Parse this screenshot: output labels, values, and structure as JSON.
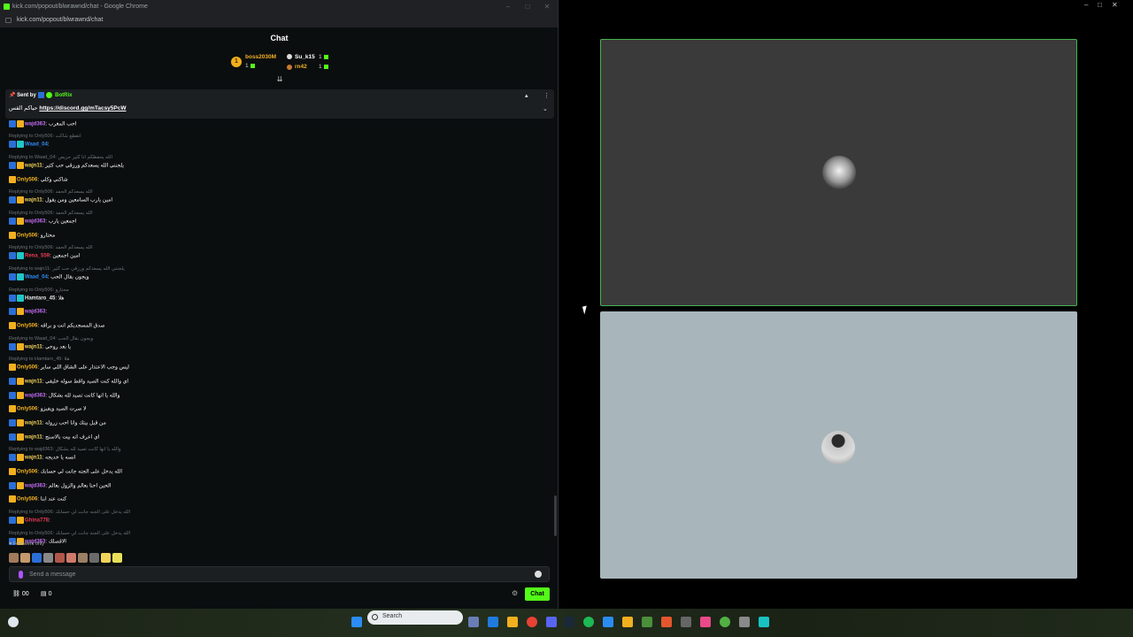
{
  "browser": {
    "title": "kick.com/popout/blwrawnd/chat - Google Chrome",
    "url": "kick.com/popout/blwrawnd/chat"
  },
  "chat": {
    "header": "Chat",
    "leaderboard": [
      {
        "rank": "1",
        "name": "boss2030M",
        "count": "1",
        "color": "#f2b01e"
      },
      {
        "rank": "",
        "name": "Su_k15",
        "count": "1",
        "color": "#ffffff"
      },
      {
        "rank": "",
        "name": "rn42",
        "count": "1",
        "color": "#f2b01e"
      }
    ],
    "pinned": {
      "sent_by": "Sent by",
      "bot_name": "BotRix",
      "text": "حياكم القس",
      "link": "https://discord.gg/mTacsy5PcW"
    },
    "messages": [
      {
        "reply": "",
        "user": "wajd363",
        "color": "#c36cf5",
        "text": "احب المغرب"
      },
      {
        "reply": "Replying to Only506: انقطع شاكت",
        "user": "Waad_04",
        "color": "#2b8cf4",
        "text": ""
      },
      {
        "reply": "Replying to Waad_04: الله يحفظكم انا كثير حريص",
        "user": "wajn11",
        "color": "#f2d35a",
        "text": "يلجنني الله يسعدكم ورزقي حب كثير"
      },
      {
        "reply": "",
        "user": "Only506",
        "color": "#f2b01e",
        "text": "شاكني وكلي"
      },
      {
        "reply": "Replying to Only506: الله يسعدكم الحمد",
        "user": "wajn11",
        "color": "#f2d35a",
        "text": "امين يارب السامعين ومن يقول"
      },
      {
        "reply": "Replying to Only506: الله يسعدكم الحمد",
        "user": "wajd363",
        "color": "#c36cf5",
        "text": "اجمعين يارب"
      },
      {
        "reply": "",
        "user": "Only506",
        "color": "#f2b01e",
        "text": "محتارو"
      },
      {
        "reply": "Replying to Only506: الله يسعدكم الحمد",
        "user": "Rena_559",
        "color": "#ea3a55",
        "text": "امين اجمعين"
      },
      {
        "reply": "Replying to wajn11: يلجنني الله يسعدكم ورزقي حب كثير",
        "user": "Waad_04",
        "color": "#2b8cf4",
        "text": "ويجون بقال الحب"
      },
      {
        "reply": "Replying to Only506: محتارو",
        "user": "Hamtaro_45",
        "color": "#e8e8e8",
        "text": "هلا"
      },
      {
        "reply": "",
        "user": "wajd363",
        "color": "#c36cf5",
        "text": ""
      },
      {
        "reply": "",
        "user": "Only506",
        "color": "#f2b01e",
        "text": "صدق المسجديكم انت و براقه"
      },
      {
        "reply": "Replying to Waad_04: ويجون بقال الحب",
        "user": "wajn11",
        "color": "#f2d35a",
        "text": "يا بعد روحي"
      },
      {
        "reply": "Replying to Hamtaro_45: هلا",
        "user": "Only506",
        "color": "#f2b01e",
        "text": "ليس وجب الاعتذار على الشاق اللي ساير"
      },
      {
        "reply": "",
        "user": "wajn11",
        "color": "#f2d35a",
        "text": "اي والله كنت الصيد واقط سوله خليقي"
      },
      {
        "reply": "",
        "user": "wajd363",
        "color": "#c36cf5",
        "text": "والله يا انها كانت تصيد لله بشكال"
      },
      {
        "reply": "",
        "user": "Only506",
        "color": "#f2b01e",
        "text": "لا صرت الصيد ويفيزو"
      },
      {
        "reply": "",
        "user": "wajn11",
        "color": "#f2d35a",
        "text": "من قبل بيتك وانا احب زروله"
      },
      {
        "reply": "",
        "user": "wajn11",
        "color": "#f2d35a",
        "text": "اي اعرف انه بيت بالاسنج"
      },
      {
        "reply": "Replying to wajd363: والله يا انها كانت تصيد لله بشكال",
        "user": "wajn11",
        "color": "#f2d35a",
        "text": "انسه يا خديجه"
      },
      {
        "reply": "",
        "user": "Only506",
        "color": "#f2b01e",
        "text": "الله يدخل على الجنه جانت لي حسابك"
      },
      {
        "reply": "",
        "user": "wajd363",
        "color": "#c36cf5",
        "text": "الحين احنا بعالم والزول بعالم"
      },
      {
        "reply": "",
        "user": "Only506",
        "color": "#f2b01e",
        "text": "كنت عند ابنا"
      },
      {
        "reply": "Replying to Only506: الله يدخل على الجنه جانت لي حسابك",
        "user": "Ghina778",
        "color": "#ea3a55",
        "text": ""
      },
      {
        "reply": "Replying to Only506: الله يدخل على الجنه جانت لي حسابك",
        "user": "wajd363",
        "color": "#c36cf5",
        "text": "الاقصلك"
      }
    ],
    "followers_only": "Followers only",
    "input_placeholder": "Send a message",
    "footer": {
      "viewers": "00",
      "gifts": "0",
      "send_label": "Chat"
    }
  },
  "taskbar": {
    "search_label": "Search"
  }
}
